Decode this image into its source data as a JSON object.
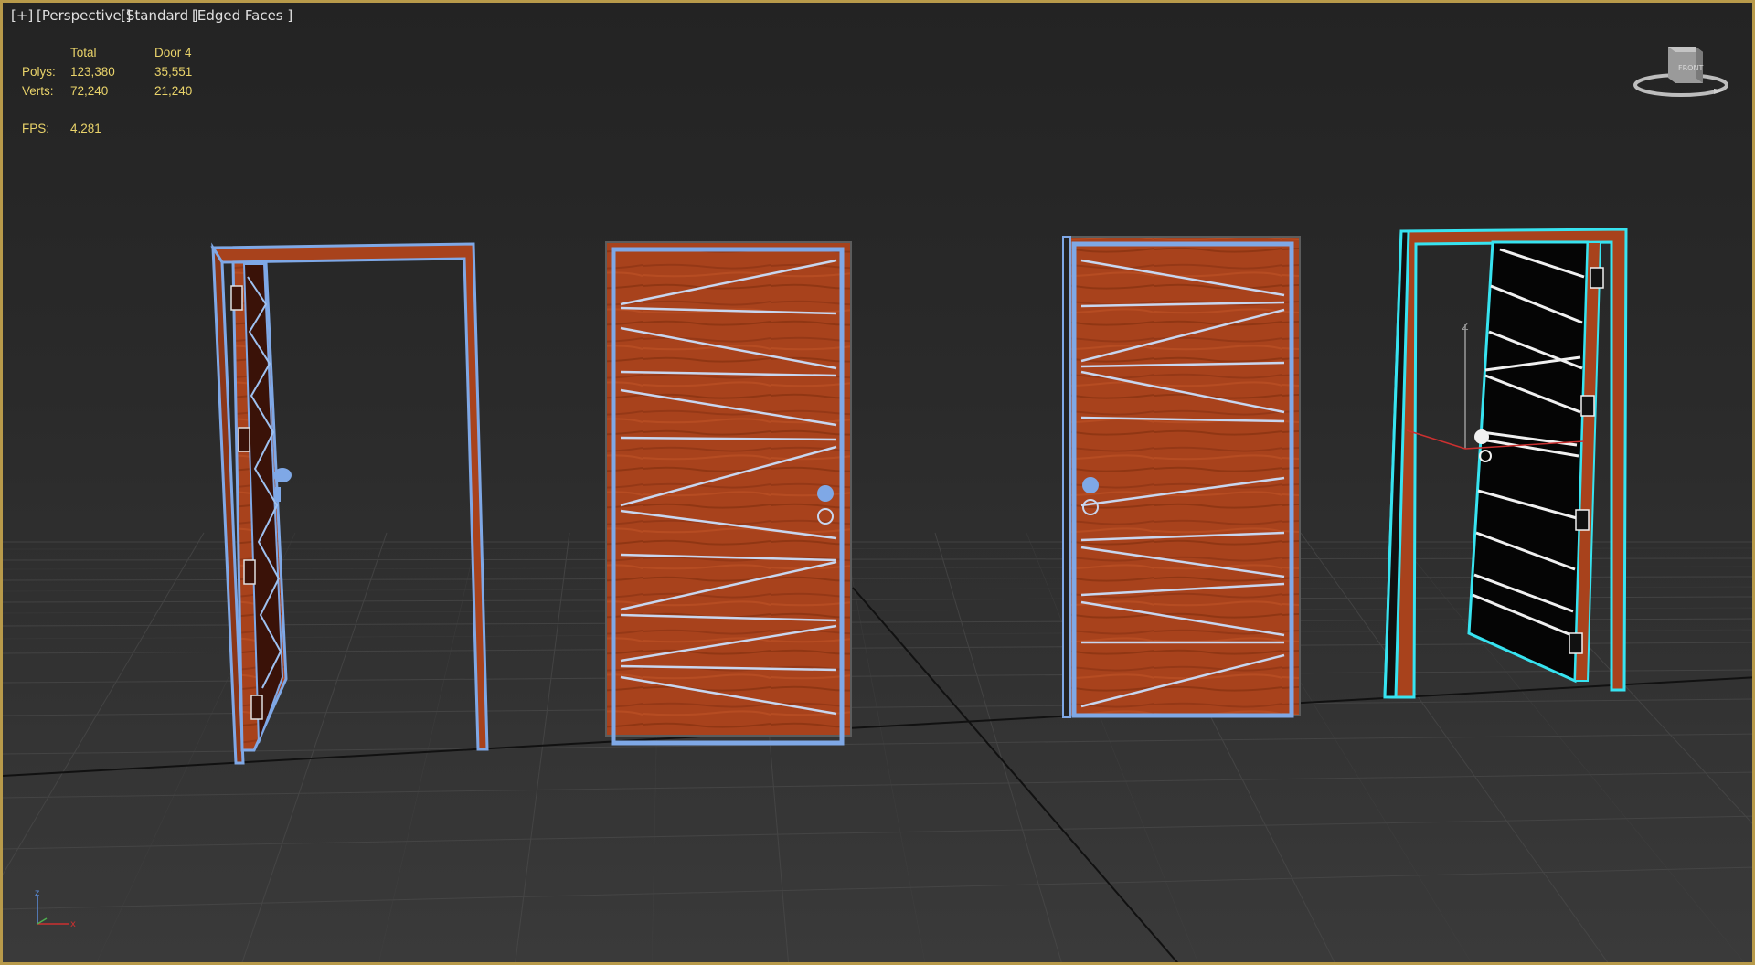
{
  "viewport": {
    "labels": {
      "plus": "[+]",
      "view": "[Perspective ]",
      "shading": "[Standard ]",
      "display": "[Edged Faces ]"
    },
    "stats": {
      "col_total": "Total",
      "col_selection": "Door 4",
      "polys_label": "Polys:",
      "polys_total": "123,380",
      "polys_selection": "35,551",
      "verts_label": "Verts:",
      "verts_total": "72,240",
      "verts_selection": "21,240",
      "fps_label": "FPS:",
      "fps_value": "4.281"
    },
    "viewcube": {
      "face": "FRONT"
    },
    "gizmo": {
      "z_label": "Z"
    },
    "axis_tripod": {
      "x": "x",
      "z": "z"
    }
  },
  "colors": {
    "border": "#b89a4a",
    "stats_text": "#e9d36a",
    "wood": "#a8421c",
    "wire": "#7fa8e6",
    "selected_wire": "#37e3f0"
  }
}
